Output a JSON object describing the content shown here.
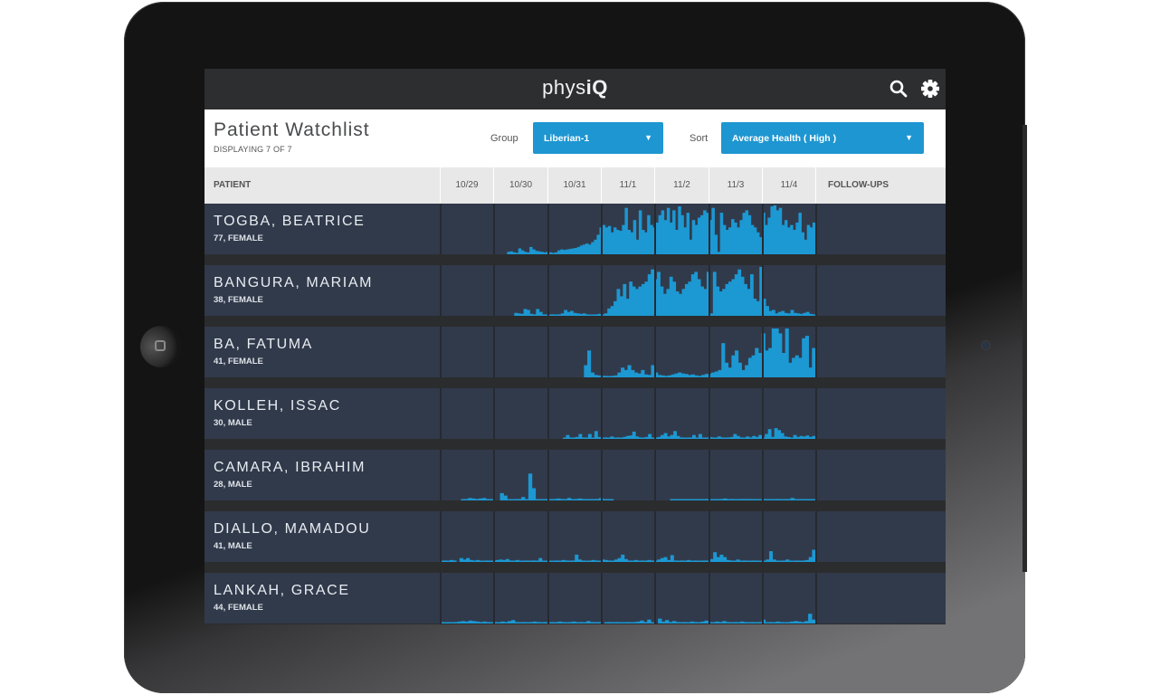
{
  "app": {
    "logo_light": "phys",
    "logo_bold": "iQ",
    "icons": {
      "search": "search-icon",
      "settings": "gear-icon"
    }
  },
  "header": {
    "title": "Patient Watchlist",
    "subtitle": "DISPLAYING 7 OF 7",
    "group_label": "Group",
    "group_value": "Liberian-1",
    "sort_label": "Sort",
    "sort_value": "Average Health ( High )",
    "caret": "▼"
  },
  "colors": {
    "accent": "#1e96d1",
    "topbar": "#2d2e30",
    "row_bg": "#313a4b",
    "bar": "#1c98d3"
  },
  "columns": {
    "patient": "PATIENT",
    "days": [
      "10/29",
      "10/30",
      "10/31",
      "11/1",
      "11/2",
      "11/3",
      "11/4"
    ],
    "followups": "FOLLOW-UPS"
  },
  "patients": [
    {
      "name": "TOGBA, BEATRICE",
      "meta": "77, FEMALE",
      "activity": [
        0,
        0,
        0,
        0,
        0,
        0,
        0,
        0,
        0,
        0,
        0,
        0,
        0,
        0,
        0,
        0,
        0,
        0,
        0,
        0,
        0,
        0,
        0,
        0,
        0.05,
        0.06,
        0.04,
        0.03,
        0.12,
        0.08,
        0.05,
        0.04,
        0.15,
        0.1,
        0.07,
        0.06,
        0.05,
        0.04,
        0.05,
        0.04,
        0.03,
        0.04,
        0.08,
        0.1,
        0.09,
        0.1,
        0.11,
        0.12,
        0.13,
        0.15,
        0.18,
        0.2,
        0.22,
        0.2,
        0.25,
        0.3,
        0.4,
        0.55,
        0.6,
        0.55,
        0.58,
        0.45,
        0.55,
        0.5,
        0.48,
        0.6,
        0.95,
        0.5,
        0.45,
        0.7,
        0.3,
        0.9,
        0.5,
        0.45,
        0.8,
        0.6,
        0.55,
        0.65,
        0.8,
        0.9,
        0.7,
        0.95,
        0.65,
        0.9,
        0.5,
        0.98,
        0.8,
        0.55,
        0.85,
        0.3,
        0.7,
        0.6,
        0.75,
        0.8,
        0.9,
        0.85,
        0.7,
        0.95,
        0.4,
        0.05,
        0.85,
        0.6,
        0.5,
        0.55,
        0.72,
        0.65,
        0.55,
        0.7,
        0.85,
        0.9,
        0.8,
        0.6,
        0.55,
        0.45,
        0.35,
        0.85,
        0.6,
        0.75,
        0.98,
        1.0,
        0.9,
        0.95,
        0.6,
        0.7,
        0.55,
        0.6,
        0.5,
        0.65,
        0.85,
        0.45,
        0.3,
        0.6,
        0.55,
        0.65
      ]
    },
    {
      "name": "BANGURA, MARIAM",
      "meta": "38, FEMALE",
      "activity": [
        0,
        0,
        0,
        0,
        0,
        0,
        0,
        0,
        0,
        0,
        0,
        0,
        0,
        0,
        0,
        0,
        0,
        0,
        0,
        0,
        0,
        0,
        0,
        0,
        0.06,
        0.05,
        0.04,
        0.14,
        0.12,
        0.04,
        0.03,
        0.14,
        0.08,
        0.03,
        0.02,
        0.02,
        0.03,
        0.02,
        0.03,
        0.05,
        0.12,
        0.08,
        0.1,
        0.06,
        0.05,
        0.04,
        0.05,
        0.03,
        0.02,
        0.02,
        0.03,
        0.04,
        0.03,
        0.05,
        0.15,
        0.2,
        0.3,
        0.55,
        0.4,
        0.65,
        0.35,
        0.7,
        0.6,
        0.55,
        0.6,
        0.65,
        0.7,
        0.85,
        0.95,
        0.75,
        0.9,
        0.6,
        0.45,
        0.55,
        0.8,
        0.7,
        0.5,
        0.45,
        0.55,
        0.65,
        0.7,
        0.85,
        0.9,
        0.75,
        0.6,
        0.55,
        0.9,
        0.05,
        0.9,
        0.6,
        0.5,
        0.55,
        0.65,
        0.7,
        0.75,
        0.85,
        0.95,
        0.8,
        0.65,
        0.55,
        0.85,
        0.35,
        0.3,
        1.0,
        0.35,
        0.2,
        0.1,
        0.12,
        0.05,
        0.08,
        0.1,
        0.06,
        0.05,
        0.12,
        0.06,
        0.05,
        0.04,
        0.06,
        0.08,
        0.04,
        0.03
      ]
    },
    {
      "name": "BA, FATUMA",
      "meta": "41, FEMALE",
      "activity": [
        0,
        0,
        0,
        0,
        0,
        0,
        0,
        0,
        0,
        0,
        0,
        0,
        0,
        0,
        0,
        0,
        0,
        0,
        0,
        0,
        0,
        0,
        0,
        0,
        0,
        0,
        0,
        0,
        0,
        0,
        0,
        0,
        0,
        0,
        0,
        0,
        0,
        0,
        0,
        0,
        0,
        0,
        0,
        0.25,
        0.55,
        0.1,
        0.05,
        0.04,
        0.03,
        0.03,
        0.02,
        0.03,
        0.04,
        0.1,
        0.2,
        0.15,
        0.25,
        0.15,
        0.1,
        0.08,
        0.15,
        0.06,
        0.05,
        0.25,
        0.1,
        0.05,
        0.04,
        0.03,
        0.04,
        0.06,
        0.08,
        0.1,
        0.08,
        0.07,
        0.05,
        0.06,
        0.04,
        0.03,
        0.05,
        0.07,
        0.08,
        0.1,
        0.12,
        0.15,
        0.7,
        0.3,
        0.2,
        0.45,
        0.55,
        0.3,
        0.15,
        0.25,
        0.4,
        0.45,
        0.6,
        0.5,
        0.9,
        0.55,
        0.6,
        1.0,
        1.0,
        0.9,
        0.5,
        1.0,
        0.3,
        0.4,
        0.45,
        0.4,
        0.8,
        0.85,
        0.2,
        0.6
      ]
    },
    {
      "name": "KOLLEH, ISSAC",
      "meta": "30, MALE",
      "activity": [
        0,
        0,
        0,
        0,
        0,
        0,
        0,
        0,
        0,
        0,
        0,
        0,
        0,
        0,
        0,
        0,
        0,
        0,
        0,
        0,
        0,
        0,
        0,
        0,
        0,
        0,
        0,
        0,
        0,
        0,
        0,
        0,
        0,
        0,
        0,
        0,
        0,
        0,
        0,
        0.02,
        0.08,
        0.02,
        0.03,
        0.04,
        0.1,
        0.03,
        0.02,
        0.1,
        0.02,
        0.16,
        0.04,
        0.02,
        0.03,
        0.02,
        0.05,
        0.02,
        0.03,
        0.02,
        0.04,
        0.06,
        0.07,
        0.15,
        0.05,
        0.03,
        0.02,
        0.04,
        0.1,
        0.03,
        0.02,
        0.04,
        0.08,
        0.12,
        0.05,
        0.08,
        0.16,
        0.06,
        0.03,
        0.02,
        0.02,
        0.03,
        0.08,
        0.02,
        0.1,
        0.03,
        0.02,
        0.04,
        0.03,
        0.02,
        0.05,
        0.03,
        0.02,
        0.03,
        0.04,
        0.1,
        0.06,
        0.03,
        0.02,
        0.05,
        0.03,
        0.06,
        0.04,
        0.08,
        0.03,
        0.1,
        0.2,
        0.04,
        0.22,
        0.18,
        0.12,
        0.05,
        0.04,
        0.02,
        0.08,
        0.04,
        0.06,
        0.05,
        0.07,
        0.04,
        0.06
      ]
    },
    {
      "name": "CAMARA, IBRAHIM",
      "meta": "28, MALE",
      "activity": [
        0,
        0,
        0,
        0,
        0,
        0,
        0.02,
        0.03,
        0.05,
        0.04,
        0.03,
        0.04,
        0.05,
        0.03,
        0.01,
        0,
        0,
        0.15,
        0.1,
        0.02,
        0.02,
        0.02,
        0.03,
        0.07,
        0.02,
        0.55,
        0.25,
        0.02,
        0.02,
        0.02,
        0.03,
        0.02,
        0.03,
        0.04,
        0.03,
        0.02,
        0.05,
        0.02,
        0.03,
        0.04,
        0.03,
        0.02,
        0.02,
        0.02,
        0.03,
        0.05,
        0.02,
        0.02,
        0.02,
        0,
        0,
        0,
        0,
        0,
        0,
        0,
        0,
        0,
        0,
        0,
        0,
        0,
        0,
        0,
        0,
        0.02,
        0.02,
        0.02,
        0.02,
        0.02,
        0.02,
        0.02,
        0.02,
        0.02,
        0.02,
        0.03,
        0.02,
        0.02,
        0.02,
        0.03,
        0.04,
        0.02,
        0.03,
        0.02,
        0.02,
        0.03,
        0.02,
        0.03,
        0.02,
        0.02,
        0.02,
        0.02,
        0.02,
        0.02,
        0.02,
        0.03,
        0.02,
        0.02,
        0.02,
        0.05,
        0.02,
        0.02,
        0.02,
        0.02,
        0.02,
        0.02
      ]
    },
    {
      "name": "DIALLO, MAMADOU",
      "meta": "41, MALE",
      "activity": [
        0.02,
        0.03,
        0.02,
        0.04,
        0.03,
        0,
        0.08,
        0.05,
        0.08,
        0.04,
        0.03,
        0.04,
        0.02,
        0.02,
        0.03,
        0.02,
        0.03,
        0.04,
        0.05,
        0.04,
        0.06,
        0.03,
        0.02,
        0.04,
        0.02,
        0.02,
        0.03,
        0.02,
        0.03,
        0.02,
        0.08,
        0.02,
        0.02,
        0.02,
        0.02,
        0.03,
        0.02,
        0.04,
        0.03,
        0.02,
        0.03,
        0.15,
        0.05,
        0.03,
        0.02,
        0.02,
        0.04,
        0.03,
        0.02,
        0.05,
        0.04,
        0.03,
        0.02,
        0.05,
        0.08,
        0.15,
        0.06,
        0.03,
        0.02,
        0.04,
        0.02,
        0.03,
        0.02,
        0.04,
        0.03,
        0.02,
        0.05,
        0.08,
        0.1,
        0.04,
        0.14,
        0.03,
        0.02,
        0.03,
        0.02,
        0.04,
        0.02,
        0.03,
        0.02,
        0.02,
        0.03,
        0.02,
        0.06,
        0.2,
        0.1,
        0.15,
        0.1,
        0.04,
        0.03,
        0.02,
        0.05,
        0.02,
        0.03,
        0.02,
        0.02,
        0.03,
        0.02,
        0.02,
        0.02,
        0.05,
        0.22,
        0.05,
        0.02,
        0.02,
        0.03,
        0.05,
        0.02,
        0.02,
        0.03,
        0.02,
        0.03,
        0.04,
        0.1,
        0.25
      ]
    },
    {
      "name": "LANKAH, GRACE",
      "meta": "44, FEMALE",
      "activity": [
        0.03,
        0.02,
        0.03,
        0.02,
        0.03,
        0.04,
        0.05,
        0.04,
        0.06,
        0.05,
        0.04,
        0.03,
        0.04,
        0.03,
        0.02,
        0.03,
        0.02,
        0.04,
        0.03,
        0.05,
        0.07,
        0.03,
        0.02,
        0.03,
        0.02,
        0.03,
        0.04,
        0.03,
        0.02,
        0.03,
        0.02,
        0.03,
        0.02,
        0.04,
        0.03,
        0.02,
        0.03,
        0.04,
        0.02,
        0.03,
        0.02,
        0.05,
        0.03,
        0.02,
        0.03,
        0,
        0.02,
        0.03,
        0.02,
        0.03,
        0.02,
        0.02,
        0.03,
        0.02,
        0.03,
        0.04,
        0.06,
        0.03,
        0.08,
        0.02,
        0,
        0.1,
        0.04,
        0.07,
        0.03,
        0.05,
        0.03,
        0.02,
        0.03,
        0.02,
        0.04,
        0.03,
        0.02,
        0.04,
        0.06,
        0.03,
        0.02,
        0.04,
        0.03,
        0.05,
        0.03,
        0.02,
        0.03,
        0.02,
        0.04,
        0.03,
        0.02,
        0.03,
        0.02,
        0.03,
        0.08,
        0.02,
        0.03,
        0.02,
        0.04,
        0.03,
        0.02,
        0.03,
        0.04,
        0.05,
        0.04,
        0.03,
        0.05,
        0.2,
        0.08
      ]
    }
  ]
}
